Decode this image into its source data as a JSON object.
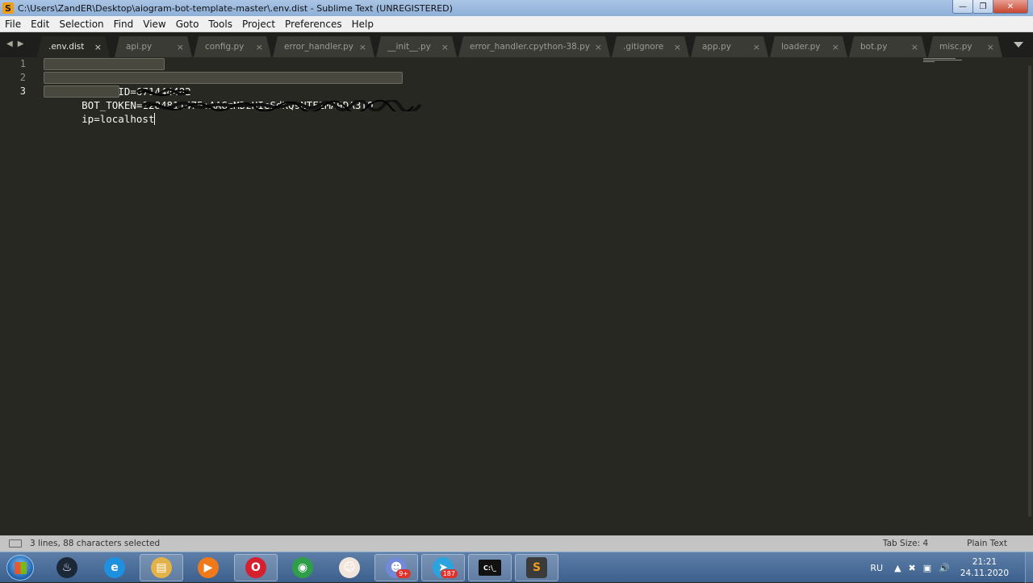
{
  "window": {
    "title": "C:\\Users\\ZandER\\Desktop\\aiogram-bot-template-master\\.env.dist - Sublime Text (UNREGISTERED)",
    "app_icon_glyph": "S",
    "minimize": "—",
    "maximize": "❐",
    "close": "✕"
  },
  "menu": [
    "File",
    "Edit",
    "Selection",
    "Find",
    "View",
    "Goto",
    "Tools",
    "Project",
    "Preferences",
    "Help"
  ],
  "tabs": {
    "nav_back": "◀",
    "nav_forward": "▶",
    "close_glyph": "×",
    "items": [
      {
        "label": ".env.dist",
        "active": true
      },
      {
        "label": "api.py",
        "active": false
      },
      {
        "label": "config.py",
        "active": false
      },
      {
        "label": "error_handler.py",
        "active": false
      },
      {
        "label": "__init__.py",
        "active": false
      },
      {
        "label": "error_handler.cpython-38.pyc",
        "active": false
      },
      {
        "label": ".gitignore",
        "active": false
      },
      {
        "label": "app.py",
        "active": false
      },
      {
        "label": "loader.py",
        "active": false
      },
      {
        "label": "bot.py",
        "active": false
      },
      {
        "label": "misc.py",
        "active": false
      }
    ]
  },
  "editor": {
    "line_numbers": [
      "1",
      "2",
      "3"
    ],
    "lines": [
      {
        "prefix": "ADMIN_ID=",
        "redacted_text": "671444482"
      },
      {
        "prefix": "BOT_TOKEN=",
        "redacted_text": "1284811475:AAGzMDzHIeSdKQ9NTF1MA9DA3TO"
      },
      {
        "prefix": "ip=localhost",
        "redacted_text": ""
      }
    ]
  },
  "status": {
    "selection_info": "3 lines, 88 characters selected",
    "tab_size": "Tab Size: 4",
    "syntax": "Plain Text"
  },
  "taskbar": {
    "apps": [
      {
        "name": "steam",
        "glyph": "♨",
        "color": "#1b2838"
      },
      {
        "name": "internet-explorer",
        "glyph": "e",
        "color": "#1e90e0"
      },
      {
        "name": "file-explorer",
        "glyph": "▤",
        "color": "#e3b34a"
      },
      {
        "name": "media-player",
        "glyph": "▶",
        "color": "#f07a1a"
      },
      {
        "name": "opera",
        "glyph": "O",
        "color": "#d6202f"
      },
      {
        "name": "chrome",
        "glyph": "◉",
        "color": "#2f9e48"
      },
      {
        "name": "anime-app",
        "glyph": "☺",
        "color": "#f2e6dc"
      },
      {
        "name": "discord",
        "glyph": "☻",
        "color": "#7289da",
        "badge": "9+"
      },
      {
        "name": "telegram",
        "glyph": "➤",
        "color": "#2aa3de",
        "badge": "187"
      },
      {
        "name": "cmd",
        "glyph": "C:\\_",
        "color": "#111111"
      },
      {
        "name": "sublime-text",
        "glyph": "S",
        "color": "#3b3b3b"
      }
    ],
    "lang": "RU",
    "tray_up": "▲",
    "tray_icons": [
      "✖",
      "▣",
      "🔊"
    ],
    "time": "21:21",
    "date": "24.11.2020"
  }
}
